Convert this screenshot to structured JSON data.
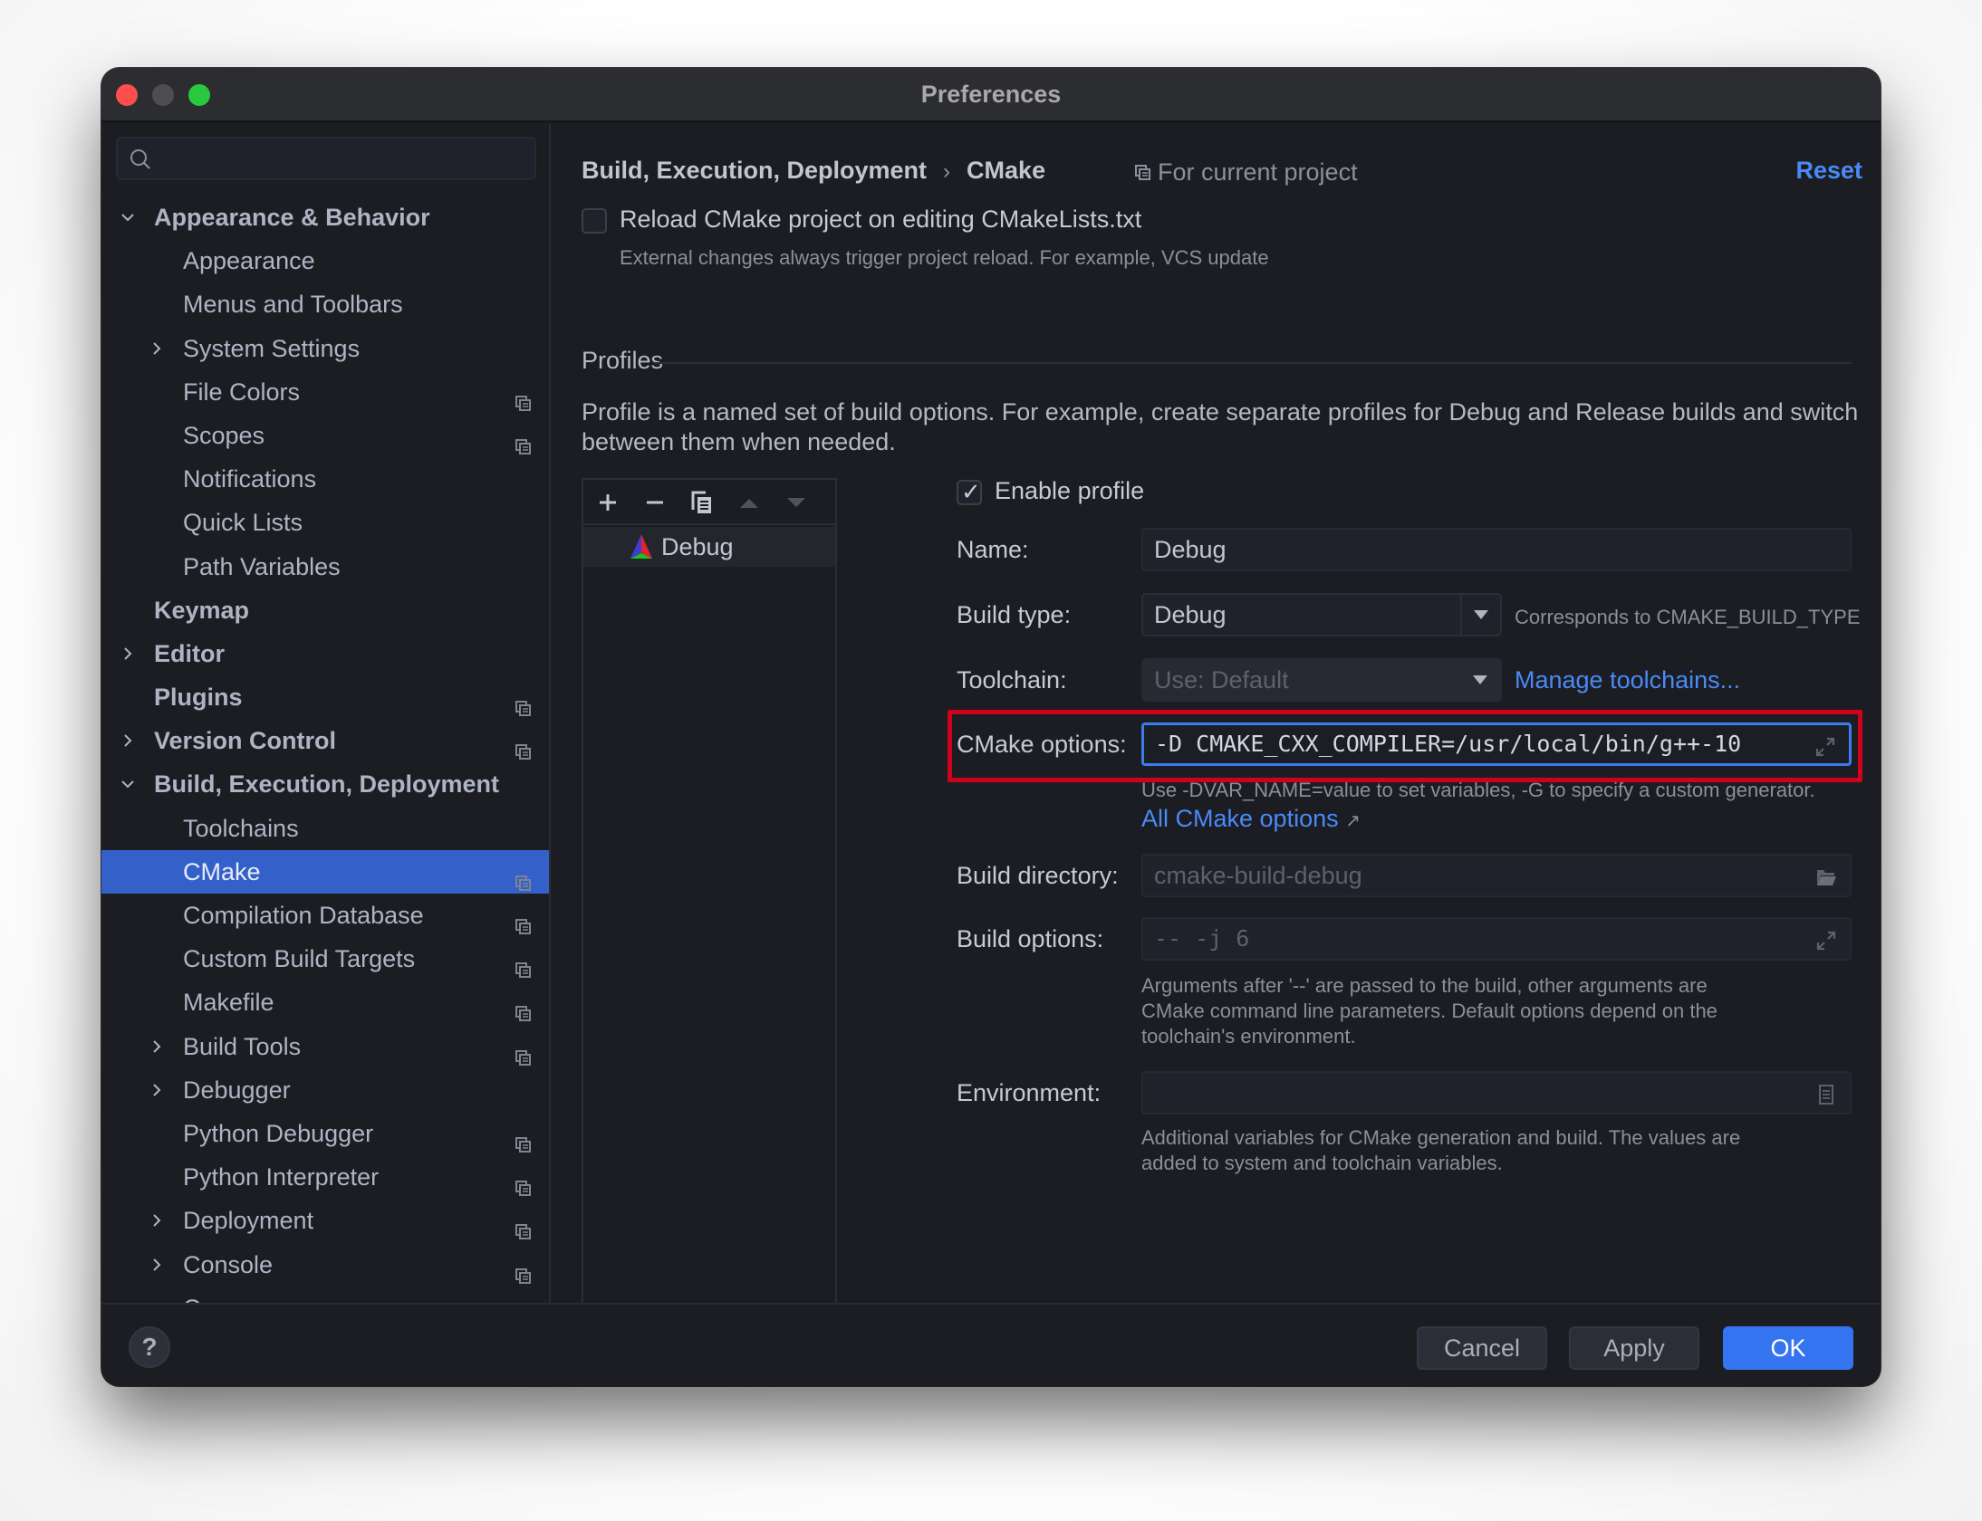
{
  "window": {
    "title": "Preferences"
  },
  "sidebar": {
    "search": {
      "placeholder": "",
      "value": ""
    },
    "items": [
      {
        "label": "Appearance & Behavior",
        "level": 0,
        "expander": "expanded",
        "bold": true,
        "project_icon": false
      },
      {
        "label": "Appearance",
        "level": 1,
        "expander": "none",
        "bold": false,
        "project_icon": false
      },
      {
        "label": "Menus and Toolbars",
        "level": 1,
        "expander": "none",
        "bold": false,
        "project_icon": false
      },
      {
        "label": "System Settings",
        "level": 1,
        "expander": "collapsed",
        "bold": false,
        "project_icon": false
      },
      {
        "label": "File Colors",
        "level": 1,
        "expander": "none",
        "bold": false,
        "project_icon": true
      },
      {
        "label": "Scopes",
        "level": 1,
        "expander": "none",
        "bold": false,
        "project_icon": true
      },
      {
        "label": "Notifications",
        "level": 1,
        "expander": "none",
        "bold": false,
        "project_icon": false
      },
      {
        "label": "Quick Lists",
        "level": 1,
        "expander": "none",
        "bold": false,
        "project_icon": false
      },
      {
        "label": "Path Variables",
        "level": 1,
        "expander": "none",
        "bold": false,
        "project_icon": false
      },
      {
        "label": "Keymap",
        "level": 0,
        "expander": "none",
        "bold": true,
        "project_icon": false
      },
      {
        "label": "Editor",
        "level": 0,
        "expander": "collapsed",
        "bold": true,
        "project_icon": false
      },
      {
        "label": "Plugins",
        "level": 0,
        "expander": "none",
        "bold": true,
        "project_icon": true
      },
      {
        "label": "Version Control",
        "level": 0,
        "expander": "collapsed",
        "bold": true,
        "project_icon": true
      },
      {
        "label": "Build, Execution, Deployment",
        "level": 0,
        "expander": "expanded",
        "bold": true,
        "project_icon": false
      },
      {
        "label": "Toolchains",
        "level": 1,
        "expander": "none",
        "bold": false,
        "project_icon": false
      },
      {
        "label": "CMake",
        "level": 1,
        "expander": "none",
        "bold": false,
        "project_icon": true,
        "selected": true
      },
      {
        "label": "Compilation Database",
        "level": 1,
        "expander": "none",
        "bold": false,
        "project_icon": true
      },
      {
        "label": "Custom Build Targets",
        "level": 1,
        "expander": "none",
        "bold": false,
        "project_icon": true
      },
      {
        "label": "Makefile",
        "level": 1,
        "expander": "none",
        "bold": false,
        "project_icon": true
      },
      {
        "label": "Build Tools",
        "level": 1,
        "expander": "collapsed",
        "bold": false,
        "project_icon": true
      },
      {
        "label": "Debugger",
        "level": 1,
        "expander": "collapsed",
        "bold": false,
        "project_icon": false
      },
      {
        "label": "Python Debugger",
        "level": 1,
        "expander": "none",
        "bold": false,
        "project_icon": true
      },
      {
        "label": "Python Interpreter",
        "level": 1,
        "expander": "none",
        "bold": false,
        "project_icon": true
      },
      {
        "label": "Deployment",
        "level": 1,
        "expander": "collapsed",
        "bold": false,
        "project_icon": true
      },
      {
        "label": "Console",
        "level": 1,
        "expander": "collapsed",
        "bold": false,
        "project_icon": true
      },
      {
        "label": "Coverage",
        "level": 1,
        "expander": "none",
        "bold": false,
        "project_icon": true
      }
    ]
  },
  "header": {
    "breadcrumb_parent": "Build, Execution, Deployment",
    "breadcrumb_separator": "›",
    "breadcrumb_current": "CMake",
    "scope_label": "For current project",
    "reset_label": "Reset"
  },
  "reload": {
    "checked": false,
    "label": "Reload CMake project on editing CMakeLists.txt",
    "hint": "External changes always trigger project reload. For example, VCS update"
  },
  "profiles": {
    "section_title": "Profiles",
    "description": "Profile is a named set of build options. For example, create separate profiles for Debug and Release builds and switch between them when needed.",
    "toolbar": [
      "add",
      "remove",
      "copy",
      "move-up",
      "move-down"
    ],
    "list": [
      {
        "name": "Debug",
        "selected": true
      }
    ]
  },
  "form": {
    "enable_profile": {
      "checked": true,
      "label": "Enable profile"
    },
    "name": {
      "label": "Name:",
      "value": "Debug"
    },
    "build_type": {
      "label": "Build type:",
      "value": "Debug",
      "note": "Corresponds to CMAKE_BUILD_TYPE"
    },
    "toolchain": {
      "label": "Toolchain:",
      "value": "Use: Default",
      "disabled": true,
      "link": "Manage toolchains..."
    },
    "cmake_options": {
      "label": "CMake options:",
      "value": "-D CMAKE_CXX_COMPILER=/usr/local/bin/g++-10",
      "hint": "Use -DVAR_NAME=value to set variables, -G to specify a custom generator.",
      "link": "All CMake options",
      "link_arrow": "↗",
      "highlight_color": "#d0021b"
    },
    "build_directory": {
      "label": "Build directory:",
      "placeholder": "cmake-build-debug"
    },
    "build_options": {
      "label": "Build options:",
      "placeholder": "-- -j 6",
      "hint_lines": [
        "Arguments after '--' are passed to the build, other arguments are",
        "CMake command line parameters. Default options depend on the",
        "toolchain's environment."
      ]
    },
    "environment": {
      "label": "Environment:",
      "value": "",
      "hint_lines": [
        "Additional variables for CMake generation and build. The values are",
        "added to system and toolchain variables."
      ]
    }
  },
  "footer": {
    "help_label": "?",
    "cancel_label": "Cancel",
    "apply_label": "Apply",
    "ok_label": "OK"
  },
  "colors": {
    "accent": "#3574f0",
    "selection": "#3461c9",
    "link": "#4a8af7",
    "background": "#1b1d22"
  }
}
